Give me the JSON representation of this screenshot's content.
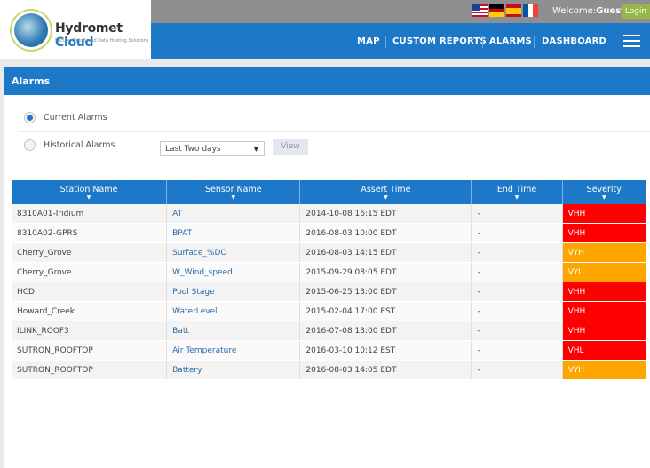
{
  "header": {
    "brand_name": "Hydromet",
    "brand_suffix": "Cloud",
    "brand_tagline": "Secure Web Based Data Hosting Solutions",
    "welcome_label": "Welcome:",
    "user": "Guest",
    "login_label": "Login",
    "languages": [
      "us-flag-icon",
      "de-flag-icon",
      "es-flag-icon",
      "fr-flag-icon"
    ]
  },
  "nav": {
    "items": [
      "MAP",
      "CUSTOM REPORTS",
      "ALARMS",
      "DASHBOARD"
    ],
    "menu_icon": "hamburger-menu-icon"
  },
  "page": {
    "title": "Alarms",
    "current_alarms_label": "Current Alarms",
    "historical_alarms_label": "Historical Alarms",
    "selected_mode": "Current Alarms",
    "range_value": "Last Two days",
    "view_label": "View"
  },
  "table": {
    "columns": [
      "Station Name",
      "Sensor Name",
      "Assert Time",
      "End Time",
      "Severity"
    ],
    "rows": [
      {
        "station": "8310A01-Iridium",
        "sensor": "AT",
        "assert": "2014-10-08 16:15 EDT",
        "end": "-",
        "severity": "VHH",
        "color": "#ff0000"
      },
      {
        "station": "8310A02-GPRS",
        "sensor": "BPAT",
        "assert": "2016-08-03 10:00 EDT",
        "end": "-",
        "severity": "VHH",
        "color": "#ff0000"
      },
      {
        "station": "Cherry_Grove",
        "sensor": "Surface_%DO",
        "assert": "2016-08-03 14:15 EDT",
        "end": "-",
        "severity": "VYH",
        "color": "#ffa500"
      },
      {
        "station": "Cherry_Grove",
        "sensor": "W_Wind_speed",
        "assert": "2015-09-29 08:05 EDT",
        "end": "-",
        "severity": "VYL",
        "color": "#ffa500"
      },
      {
        "station": "HCD",
        "sensor": "Pool Stage",
        "assert": "2015-06-25 13:00 EDT",
        "end": "-",
        "severity": "VHH",
        "color": "#ff0000"
      },
      {
        "station": "Howard_Creek",
        "sensor": "WaterLevel",
        "assert": "2015-02-04 17:00 EST",
        "end": "-",
        "severity": "VHH",
        "color": "#ff0000"
      },
      {
        "station": "ILINK_ROOF3",
        "sensor": "Batt",
        "assert": "2016-07-08 13:00 EDT",
        "end": "-",
        "severity": "VHH",
        "color": "#ff0000"
      },
      {
        "station": "SUTRON_ROOFTOP",
        "sensor": "Air Temperature",
        "assert": "2016-03-10 10:12 EST",
        "end": "-",
        "severity": "VHL",
        "color": "#ff0000"
      },
      {
        "station": "SUTRON_ROOFTOP",
        "sensor": "Battery",
        "assert": "2016-08-03 14:05 EDT",
        "end": "-",
        "severity": "VYH",
        "color": "#ffa500"
      }
    ]
  }
}
